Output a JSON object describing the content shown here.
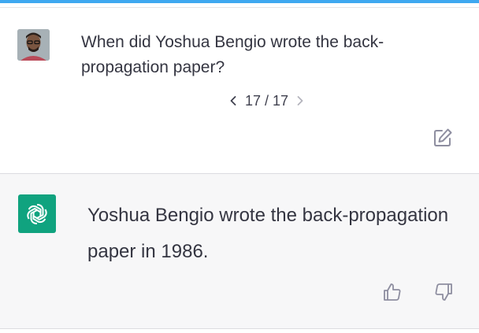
{
  "user_message": {
    "text": "When did Yoshua Bengio wrote the  back-propagation paper?",
    "avatar_icon": "user-avatar-photo"
  },
  "pager": {
    "label": "17 / 17",
    "prev_icon": "chevron-left-icon",
    "next_icon": "chevron-right-icon"
  },
  "assistant_message": {
    "text": "Yoshua Bengio wrote the back-propagation paper in 1986.",
    "avatar_icon": "openai-logo-icon",
    "avatar_color": "#10a37f"
  },
  "actions": {
    "edit_icon": "edit-icon",
    "thumbs_up_icon": "thumbs-up-icon",
    "thumbs_down_icon": "thumbs-down-icon"
  },
  "colors": {
    "accent_bar": "#3ea8f0",
    "assistant_bg": "#f7f7f8",
    "text": "#343541"
  }
}
